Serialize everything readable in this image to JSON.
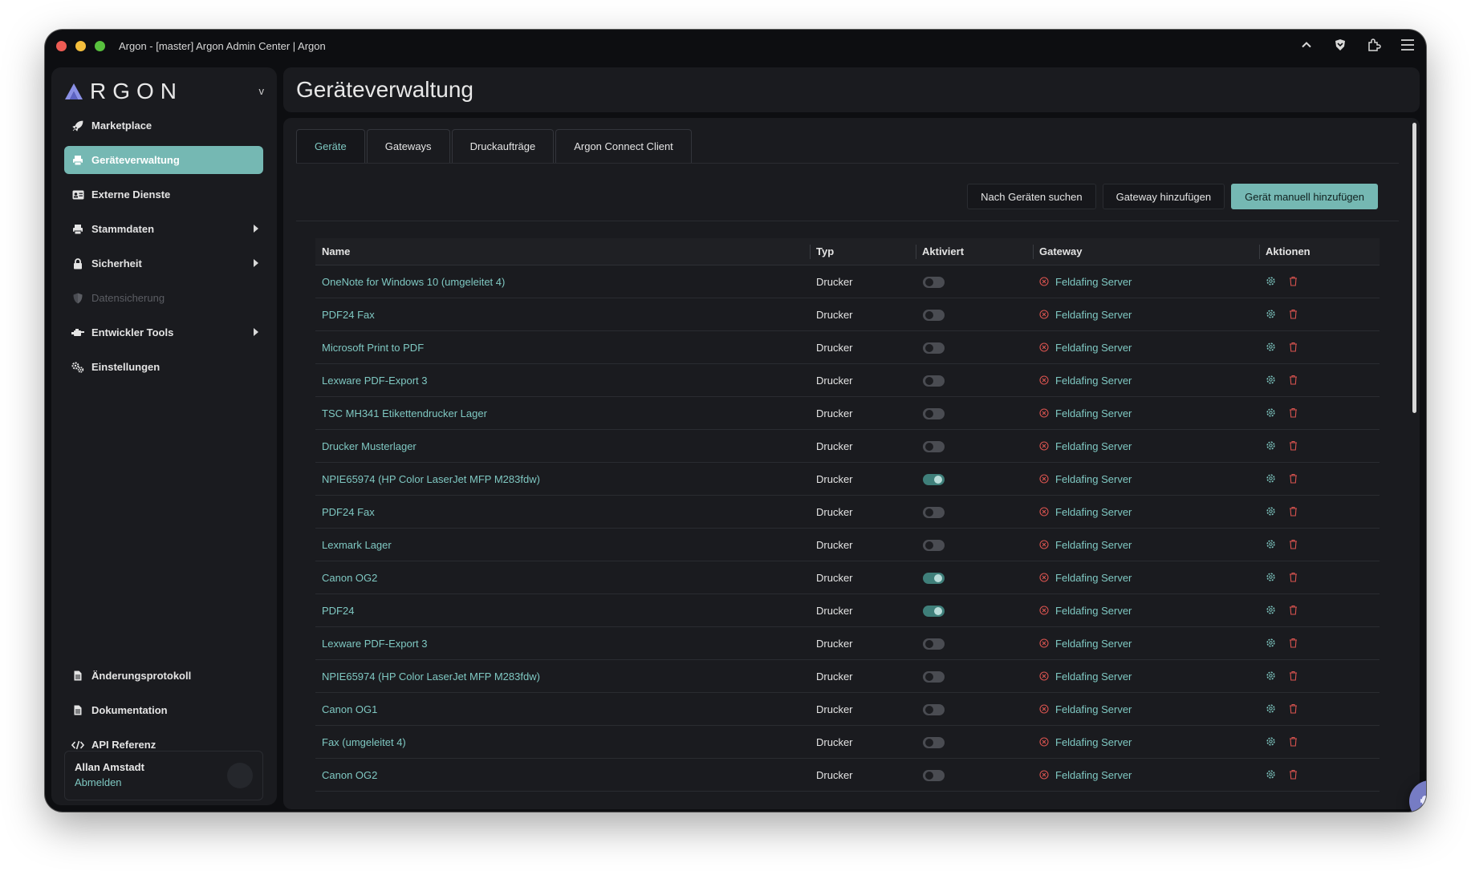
{
  "window": {
    "title": "Argon - [master] Argon Admin Center | Argon"
  },
  "sidebar": {
    "logo_text": "RGON",
    "version": "v",
    "items": [
      {
        "label": "Marketplace",
        "icon": "rocket-icon"
      },
      {
        "label": "Geräteverwaltung",
        "icon": "printer-icon",
        "active": true
      },
      {
        "label": "Externe Dienste",
        "icon": "id-card-icon"
      },
      {
        "label": "Stammdaten",
        "icon": "printer-icon",
        "expandable": true
      },
      {
        "label": "Sicherheit",
        "icon": "lock-icon",
        "expandable": true
      },
      {
        "label": "Datensicherung",
        "icon": "shield-icon",
        "disabled": true
      },
      {
        "label": "Entwickler Tools",
        "icon": "tools-icon",
        "expandable": true
      },
      {
        "label": "Einstellungen",
        "icon": "gears-icon"
      }
    ],
    "bottom_items": [
      {
        "label": "Änderungsprotokoll",
        "icon": "file-icon"
      },
      {
        "label": "Dokumentation",
        "icon": "file-icon"
      },
      {
        "label": "API Referenz",
        "icon": "code-icon"
      }
    ],
    "user": {
      "name": "Allan Amstadt",
      "logout": "Abmelden"
    }
  },
  "header": {
    "title": "Geräteverwaltung"
  },
  "tabs": [
    {
      "label": "Geräte",
      "active": true
    },
    {
      "label": "Gateways"
    },
    {
      "label": "Druckaufträge"
    },
    {
      "label": "Argon Connect Client"
    }
  ],
  "actions": {
    "search": "Nach Geräten suchen",
    "add_gateway": "Gateway hinzufügen",
    "add_device": "Gerät manuell hinzufügen"
  },
  "table": {
    "columns": [
      "Name",
      "Typ",
      "Aktiviert",
      "Gateway",
      "Aktionen"
    ],
    "rows": [
      {
        "name": "OneNote for Windows 10 (umgeleitet 4)",
        "type": "Drucker",
        "active": false,
        "gateway": "Feldafing Server"
      },
      {
        "name": "PDF24 Fax",
        "type": "Drucker",
        "active": false,
        "gateway": "Feldafing Server"
      },
      {
        "name": "Microsoft Print to PDF",
        "type": "Drucker",
        "active": false,
        "gateway": "Feldafing Server"
      },
      {
        "name": "Lexware PDF-Export 3",
        "type": "Drucker",
        "active": false,
        "gateway": "Feldafing Server"
      },
      {
        "name": "TSC MH341 Etikettendrucker Lager",
        "type": "Drucker",
        "active": false,
        "gateway": "Feldafing Server"
      },
      {
        "name": "Drucker Musterlager",
        "type": "Drucker",
        "active": false,
        "gateway": "Feldafing Server"
      },
      {
        "name": "NPIE65974 (HP Color LaserJet MFP M283fdw)",
        "type": "Drucker",
        "active": true,
        "gateway": "Feldafing Server"
      },
      {
        "name": "PDF24 Fax",
        "type": "Drucker",
        "active": false,
        "gateway": "Feldafing Server"
      },
      {
        "name": "Lexmark Lager",
        "type": "Drucker",
        "active": false,
        "gateway": "Feldafing Server"
      },
      {
        "name": "Canon OG2",
        "type": "Drucker",
        "active": true,
        "gateway": "Feldafing Server"
      },
      {
        "name": "PDF24",
        "type": "Drucker",
        "active": true,
        "gateway": "Feldafing Server"
      },
      {
        "name": "Lexware PDF-Export 3",
        "type": "Drucker",
        "active": false,
        "gateway": "Feldafing Server"
      },
      {
        "name": "NPIE65974 (HP Color LaserJet MFP M283fdw)",
        "type": "Drucker",
        "active": false,
        "gateway": "Feldafing Server"
      },
      {
        "name": "Canon OG1",
        "type": "Drucker",
        "active": false,
        "gateway": "Feldafing Server"
      },
      {
        "name": "Fax (umgeleitet 4)",
        "type": "Drucker",
        "active": false,
        "gateway": "Feldafing Server"
      },
      {
        "name": "Canon OG2",
        "type": "Drucker",
        "active": false,
        "gateway": "Feldafing Server"
      }
    ]
  },
  "colors": {
    "accent": "#75b8b3",
    "link": "#7fc8c2",
    "delete": "#d9534f",
    "gateway_offline": "#d9534f",
    "chat_button": "#767cc4"
  }
}
